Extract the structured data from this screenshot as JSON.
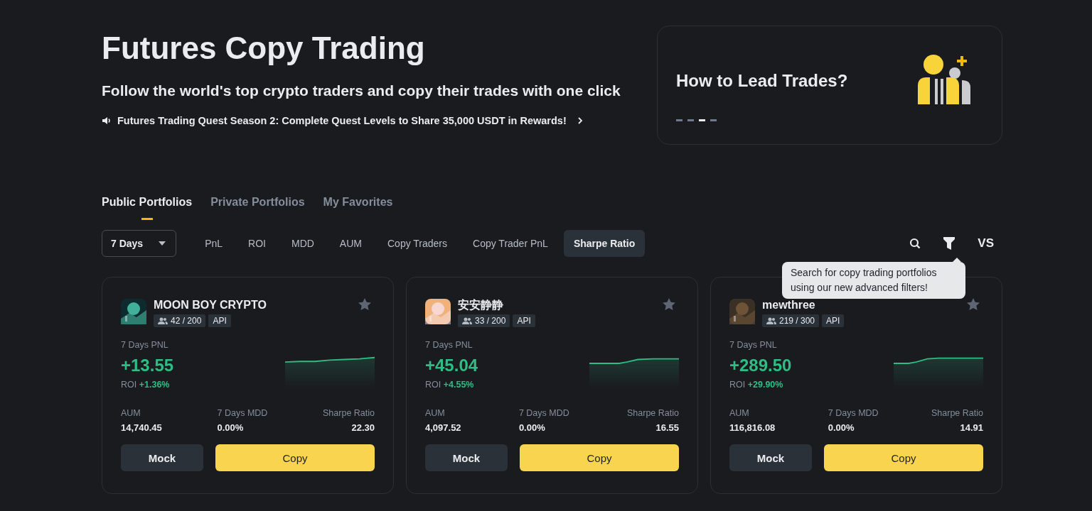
{
  "hero": {
    "title": "Futures Copy Trading",
    "subtitle": "Follow the world's top crypto traders and copy their trades with one click",
    "announcement": "Futures Trading Quest Season 2: Complete Quest Levels to Share 35,000 USDT in Rewards!"
  },
  "promo": {
    "title": "How to Lead Trades?",
    "slides": [
      {
        "selected": false
      },
      {
        "selected": false
      },
      {
        "selected": true
      },
      {
        "selected": false
      }
    ]
  },
  "tabs": [
    {
      "label": "Public Portfolios",
      "selected": true
    },
    {
      "label": "Private Portfolios",
      "selected": false
    },
    {
      "label": "My Favorites",
      "selected": false
    }
  ],
  "period": {
    "value": "7 Days"
  },
  "sort_options": [
    {
      "label": "PnL",
      "selected": false
    },
    {
      "label": "ROI",
      "selected": false
    },
    {
      "label": "MDD",
      "selected": false
    },
    {
      "label": "AUM",
      "selected": false
    },
    {
      "label": "Copy Traders",
      "selected": false
    },
    {
      "label": "Copy Trader PnL",
      "selected": false
    },
    {
      "label": "Sharpe Ratio",
      "selected": true
    }
  ],
  "toolbar": {
    "compare": "VS"
  },
  "tooltip": {
    "text": "Search for copy trading portfolios using our new advanced filters!"
  },
  "portfolios": [
    {
      "name": "MOON BOY CRYPTO",
      "followers": "42 / 200",
      "badge": "API",
      "favorite": false,
      "pnl_label": "7 Days PNL",
      "pnl": "+13.55",
      "roi_label": "ROI",
      "roi": "+1.36%",
      "stats": [
        {
          "label": "AUM",
          "value": "14,740.45"
        },
        {
          "label": "7 Days MDD",
          "value": "0.00%"
        },
        {
          "label": "Sharpe Ratio",
          "value": "22.30"
        }
      ],
      "mock": "Mock",
      "copy": "Copy"
    },
    {
      "name": "安安静静",
      "followers": "33 / 200",
      "badge": "API",
      "favorite": false,
      "pnl_label": "7 Days PNL",
      "pnl": "+45.04",
      "roi_label": "ROI",
      "roi": "+4.55%",
      "stats": [
        {
          "label": "AUM",
          "value": "4,097.52"
        },
        {
          "label": "7 Days MDD",
          "value": "0.00%"
        },
        {
          "label": "Sharpe Ratio",
          "value": "16.55"
        }
      ],
      "mock": "Mock",
      "copy": "Copy"
    },
    {
      "name": "mewthree",
      "followers": "219 / 300",
      "badge": "API",
      "favorite": false,
      "pnl_label": "7 Days PNL",
      "pnl": "+289.50",
      "roi_label": "ROI",
      "roi": "+29.90%",
      "stats": [
        {
          "label": "AUM",
          "value": "116,816.08"
        },
        {
          "label": "7 Days MDD",
          "value": "0.00%"
        },
        {
          "label": "Sharpe Ratio",
          "value": "14.91"
        }
      ],
      "mock": "Mock",
      "copy": "Copy"
    }
  ]
}
